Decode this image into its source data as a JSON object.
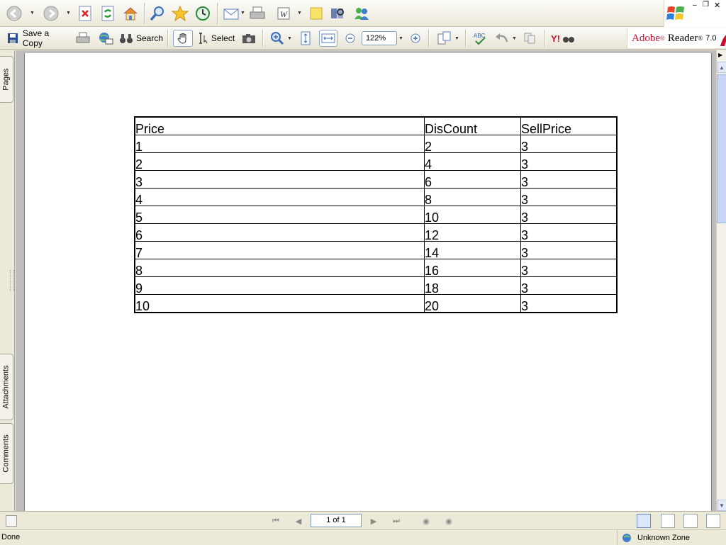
{
  "toolbar": {
    "save_copy_label": "Save a Copy",
    "search_label": "Search",
    "select_label": "Select",
    "zoom_value": "122%"
  },
  "brand": {
    "text": "Adobe® Reader® 7.0",
    "name": "Adobe",
    "product": "Reader",
    "version": "7.0"
  },
  "sidebar": {
    "tabs": [
      "Pages",
      "Attachments",
      "Comments"
    ]
  },
  "table": {
    "headers": [
      "Price",
      "DisCount",
      "SellPrice"
    ],
    "rows": [
      [
        "1",
        "2",
        "3"
      ],
      [
        "2",
        "4",
        "3"
      ],
      [
        "3",
        "6",
        "3"
      ],
      [
        "4",
        "8",
        "3"
      ],
      [
        "5",
        "10",
        "3"
      ],
      [
        "6",
        "12",
        "3"
      ],
      [
        "7",
        "14",
        "3"
      ],
      [
        "8",
        "16",
        "3"
      ],
      [
        "9",
        "18",
        "3"
      ],
      [
        "10",
        "20",
        "3"
      ]
    ]
  },
  "nav": {
    "page_indicator": "1 of 1"
  },
  "status": {
    "text": "Done",
    "zone": "Unknown Zone"
  },
  "colors": {
    "adobe_red": "#c8102e",
    "ie_blue": "#2b5fb4",
    "chrome": "#ece9d8"
  }
}
